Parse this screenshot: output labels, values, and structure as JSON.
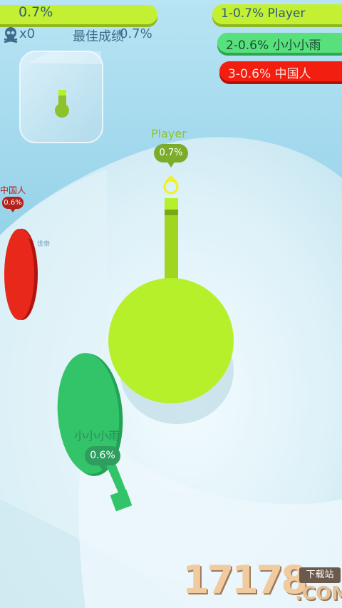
{
  "hud": {
    "progress": "0.7%",
    "kills": "x0",
    "best_label": "最佳成绩",
    "best_value": "0.7%"
  },
  "leaderboard": [
    {
      "text": "1-0.7% Player",
      "color": "#c4f033"
    },
    {
      "text": "2-0.6% 小小小雨",
      "color": "#58e07c"
    },
    {
      "text": "3-0.6% 中国人",
      "color": "#f21e10"
    }
  ],
  "players": {
    "player": {
      "name": "Player",
      "score": "0.7%",
      "color": "#b5f02a"
    },
    "rain": {
      "name": "小小小雨",
      "score": "0.6%",
      "color": "#33c46a"
    },
    "chinese": {
      "name": "中国人",
      "score": "0.6%",
      "color": "#e8281a"
    }
  },
  "map_text": "世帝",
  "watermark": {
    "number": "17178",
    "tag": "下载站",
    "domain": ".COM"
  },
  "icons": {
    "skull": "skull-icon",
    "cube": "ice-cube-icon"
  }
}
